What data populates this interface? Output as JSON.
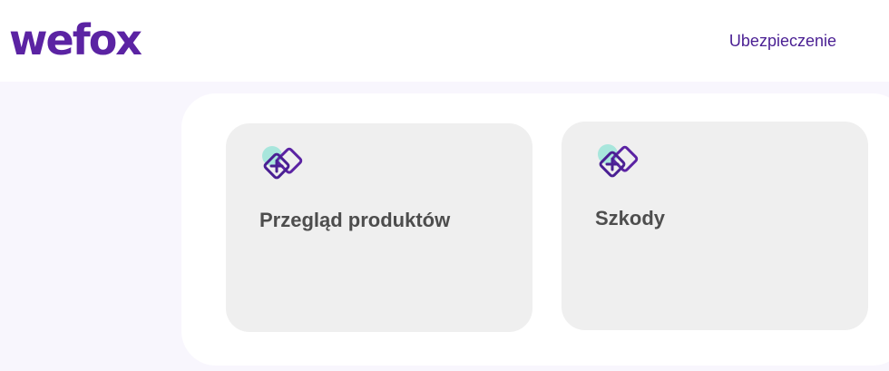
{
  "header": {
    "logo_text": "wefox",
    "nav_link_label": "Ubezpieczenie"
  },
  "cards": [
    {
      "title": "Przegląd produktów",
      "icon": "insurance-plus-icon"
    },
    {
      "title": "Szkody",
      "icon": "insurance-plus-icon"
    }
  ],
  "colors": {
    "brand": "#5b23a3",
    "icon_accent": "#a8e6dc",
    "card_bg": "#efefef",
    "page_bg": "#f8f6fd"
  }
}
